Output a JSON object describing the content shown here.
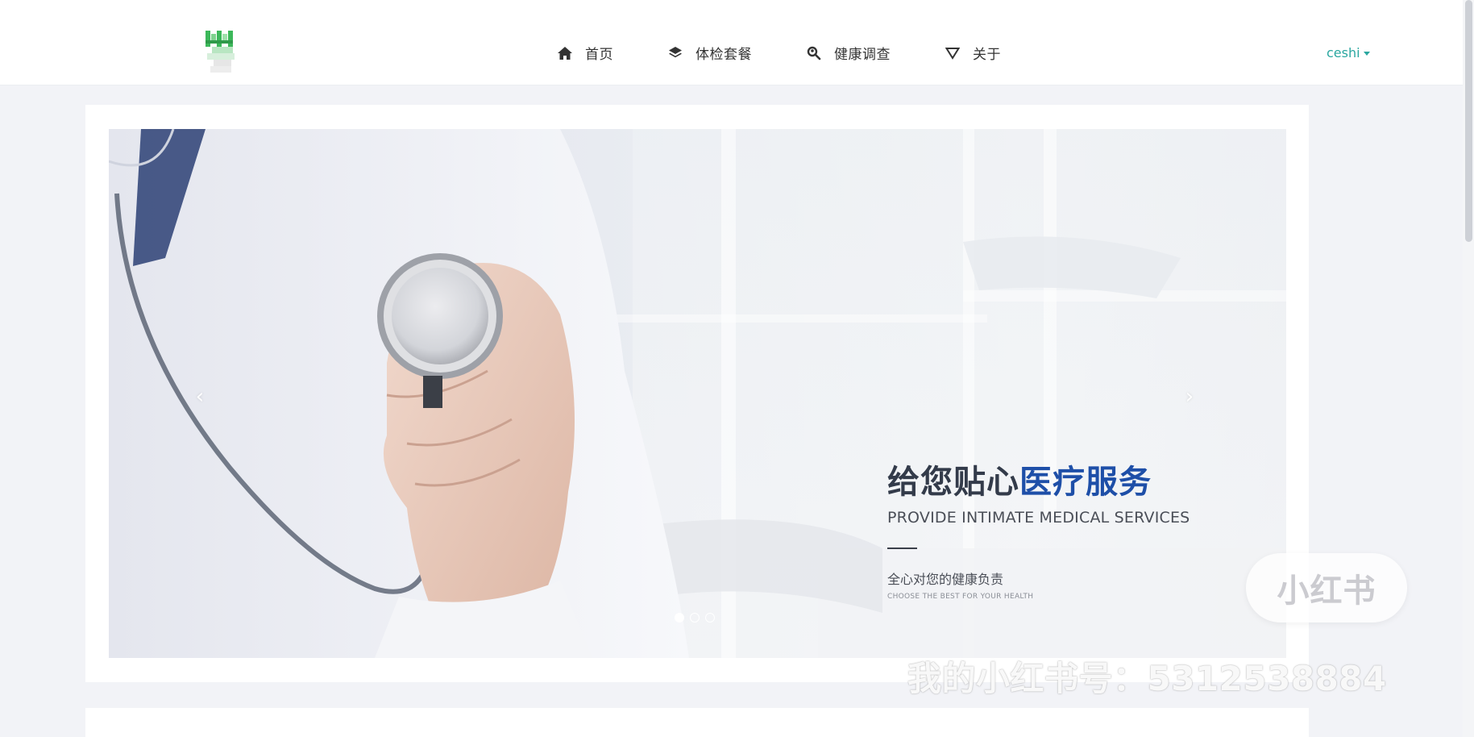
{
  "nav": {
    "items": [
      {
        "label": "首页",
        "icon": "home-icon"
      },
      {
        "label": "体检套餐",
        "icon": "layers-icon"
      },
      {
        "label": "健康调查",
        "icon": "search-user-icon"
      },
      {
        "label": "关于",
        "icon": "triangle-down-icon"
      }
    ],
    "user": "ceshi"
  },
  "slide": {
    "headline_dark": "给您贴心",
    "headline_accent": "医疗服务",
    "subtitle_en": "PROVIDE INTIMATE MEDICAL SERVICES",
    "tagline": "全心对您的健康负责",
    "tagline_en": "CHOOSE THE BEST FOR YOUR HEALTH",
    "prev_arrow": "‹",
    "next_arrow": "›",
    "slide_count": 3,
    "active_slide": 1
  },
  "watermark": {
    "badge": "小红书",
    "text": "我的小红书号：5312538884"
  },
  "colors": {
    "accent_teal": "#2aa7a0",
    "headline_blue": "#1e4fa8",
    "logo_green": "#3cb85a"
  }
}
